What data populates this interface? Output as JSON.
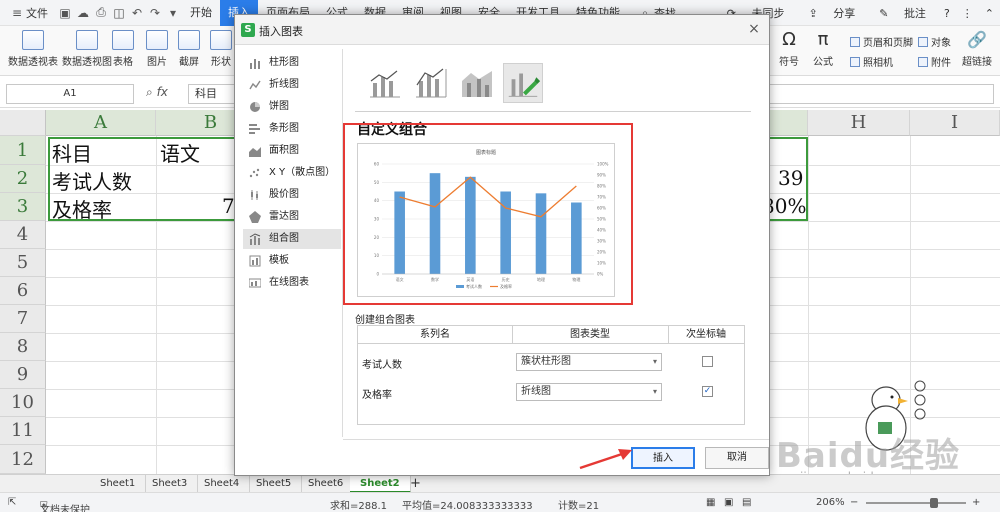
{
  "menubar": {
    "file": "文件",
    "tabs": [
      "开始",
      "插入",
      "页面布局",
      "公式",
      "数据",
      "审阅",
      "视图",
      "安全",
      "开发工具",
      "特色功能"
    ],
    "active_tab": "插入",
    "search": "查找",
    "sync": "未同步",
    "share": "分享",
    "comment": "批注"
  },
  "ribbon": {
    "pivot_table": "数据透视表",
    "pivot_chart": "数据透视图",
    "table": "表格",
    "picture": "图片",
    "screenshot": "截屏",
    "shape": "形状",
    "symbol": "符号",
    "formula": "公式",
    "header_footer": "页眉和页脚",
    "object": "对象",
    "camera": "照相机",
    "attachment": "附件",
    "hyperlink": "超链接"
  },
  "formula_bar": {
    "name_box": "A1",
    "fx": "fx",
    "content": "科目"
  },
  "sheet": {
    "columns": [
      "A",
      "B",
      "H",
      "I"
    ],
    "rows": [
      "1",
      "2",
      "3",
      "4",
      "5",
      "6",
      "7",
      "8",
      "9",
      "10",
      "11",
      "12"
    ],
    "a1": "科目",
    "b1": "语文",
    "a2": "考试人数",
    "a3": "及格率",
    "b3_partial": "7",
    "g2": "39",
    "g3": "80%"
  },
  "sheet_tabs": [
    "Sheet1",
    "Sheet3",
    "Sheet4",
    "Sheet5",
    "Sheet6",
    "Sheet2"
  ],
  "active_sheet": "Sheet2",
  "status": {
    "protect": "文档未保护",
    "sum": "求和=288.1",
    "avg": "平均值=24.008333333333",
    "count": "计数=21",
    "zoom": "206%"
  },
  "dialog": {
    "title": "插入图表",
    "chart_types": [
      "柱形图",
      "折线图",
      "饼图",
      "条形图",
      "面积图",
      "X Y（散点图）",
      "股价图",
      "雷达图",
      "组合图",
      "模板",
      "在线图表"
    ],
    "active_type": "组合图",
    "preview_title": "自定义组合",
    "combo_section_label": "创建组合图表",
    "table_headers": [
      "系列名",
      "图表类型",
      "次坐标轴"
    ],
    "series_rows": [
      {
        "name": "考试人数",
        "type": "簇状柱形图",
        "secondary": false
      },
      {
        "name": "及格率",
        "type": "折线图",
        "secondary": true
      }
    ],
    "insert_label": "插入",
    "cancel_label": "取消"
  },
  "watermark": {
    "text": "Baidu经验",
    "sub": "jingyan.baidu.com"
  },
  "chart_data": {
    "type": "bar",
    "title": "图表标题",
    "categories": [
      "语文",
      "数学",
      "英语",
      "历史",
      "地理",
      "物理"
    ],
    "series": [
      {
        "name": "考试人数",
        "kind": "bar",
        "values": [
          45,
          55,
          53,
          45,
          44,
          39
        ]
      },
      {
        "name": "及格率",
        "kind": "line",
        "values": [
          0.7,
          0.61,
          0.88,
          0.6,
          0.52,
          0.8
        ]
      }
    ],
    "ylim": [
      0,
      60
    ],
    "yticks": [
      0,
      10,
      20,
      30,
      40,
      50,
      60
    ],
    "y2lim": [
      0,
      1
    ],
    "y2ticks": [
      "0%",
      "10%",
      "20%",
      "30%",
      "40%",
      "50%",
      "60%",
      "70%",
      "80%",
      "90%",
      "100%"
    ],
    "legend": "bottom",
    "colors": {
      "bar": "#5b9bd5",
      "line": "#ed7d31"
    }
  }
}
